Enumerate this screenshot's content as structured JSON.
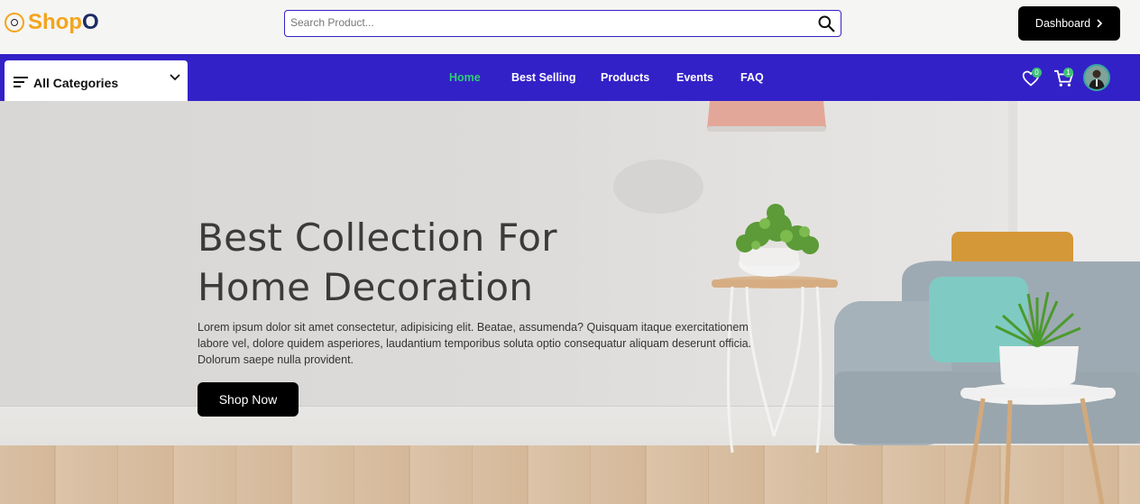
{
  "brand": {
    "name_part1": "Shop",
    "name_part2": "O"
  },
  "search": {
    "placeholder": "Search Product..."
  },
  "header": {
    "dashboard_label": "Dashboard"
  },
  "categories": {
    "label": "All Categories"
  },
  "nav": {
    "items": [
      {
        "label": "Home",
        "active": true
      },
      {
        "label": "Best Selling",
        "active": false
      },
      {
        "label": "Products",
        "active": false
      },
      {
        "label": "Events",
        "active": false
      },
      {
        "label": "FAQ",
        "active": false
      }
    ]
  },
  "wishlist": {
    "count": "0"
  },
  "cart": {
    "count": "1"
  },
  "hero": {
    "title_line1": "Best Collection For",
    "title_line2": "Home Decoration",
    "description": "Lorem ipsum dolor sit amet consectetur, adipisicing elit. Beatae, assumenda? Quisquam itaque exercitationem labore vel, dolore quidem asperiores, laudantium temporibus soluta optio consequatur aliquam deserunt officia. Dolorum saepe nulla provident.",
    "cta_label": "Shop Now"
  },
  "colors": {
    "nav_bg": "#3321c8",
    "brand_orange": "#f4a41c",
    "brand_navy": "#1d2b64",
    "active_nav": "#2ecc71",
    "badge": "#3bc177"
  }
}
